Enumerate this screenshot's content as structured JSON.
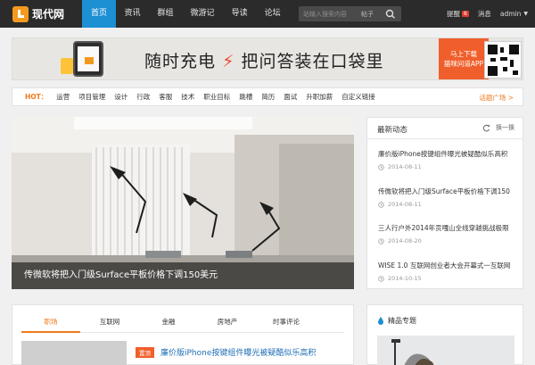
{
  "brand": {
    "name": "现代网"
  },
  "nav": {
    "items": [
      {
        "label": "首页",
        "active": true
      },
      {
        "label": "资讯"
      },
      {
        "label": "群组"
      },
      {
        "label": "微游记"
      },
      {
        "label": "导读"
      },
      {
        "label": "论坛"
      }
    ]
  },
  "search": {
    "placeholder": "站输入搜索内容",
    "type": "帖子"
  },
  "user": {
    "reminders_label": "提醒",
    "reminders_count": "6",
    "messages_label": "消息",
    "username": "admin"
  },
  "banner": {
    "slogan_left": "随时充电",
    "slogan_right": "把问答装在口袋里",
    "cta_line1": "马上下载",
    "cta_line2": "猫咪问道APP"
  },
  "hot": {
    "label": "HOT：",
    "items": [
      "运营",
      "项目管理",
      "设计",
      "行政",
      "客服",
      "技术",
      "职业目标",
      "跳槽",
      "简历",
      "面试",
      "升职加薪",
      "自定义链接"
    ],
    "more": "话题广场 >"
  },
  "hero": {
    "caption": "传微软将把入门级Surface平板价格下调150美元"
  },
  "latest": {
    "title": "最新动态",
    "refresh": "换一换",
    "items": [
      {
        "title": "廉价版iPhone按键组件曝光被疑酷似乐高积",
        "date": "2014-08-11"
      },
      {
        "title": "传微软将把入门级Surface平板价格下调150",
        "date": "2014-08-11"
      },
      {
        "title": "三人行户外2014年贡嘎山全线穿越挑战极限",
        "date": "2014-08-20"
      },
      {
        "title": "WISE 1.0 互联网创业者大会开幕式一互联网",
        "date": "2014-10-15"
      }
    ]
  },
  "tabs": {
    "items": [
      {
        "label": "职场",
        "active": true
      },
      {
        "label": "互联网"
      },
      {
        "label": "金融"
      },
      {
        "label": "房地产"
      },
      {
        "label": "时事评论"
      }
    ]
  },
  "article": {
    "tag": "置顶",
    "title": "廉价版iPhone按键组件曝光被疑酷似乐高积"
  },
  "featured": {
    "title": "精品专题"
  },
  "colors": {
    "nav_bg": "#2b2b2b",
    "accent_blue": "#1d8fd3",
    "accent_orange": "#f07a1c",
    "cta_orange": "#f05f2b",
    "badge_red": "#e03b2f"
  },
  "icons": [
    "logo-icon",
    "search-icon",
    "lightning-icon",
    "qr-code-icon",
    "refresh-icon",
    "clock-icon",
    "drop-icon"
  ]
}
